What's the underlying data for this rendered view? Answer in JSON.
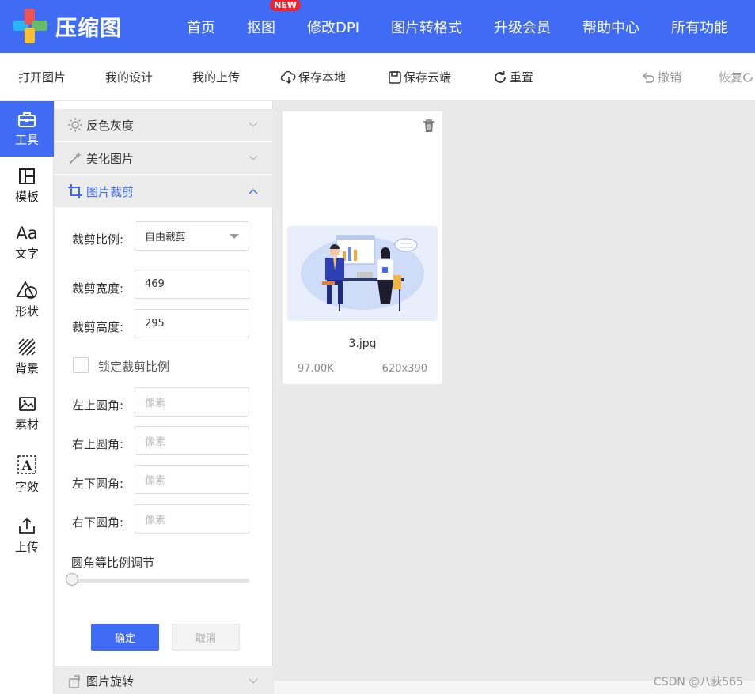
{
  "header": {
    "logo_text": "压缩图",
    "nav": [
      {
        "label": "首页"
      },
      {
        "label": "抠图",
        "badge": "NEW"
      },
      {
        "label": "修改DPI"
      },
      {
        "label": "图片转格式"
      },
      {
        "label": "升级会员"
      },
      {
        "label": "帮助中心"
      },
      {
        "label": "所有功能"
      }
    ],
    "accent_color": "#3f6bf5"
  },
  "toolbar": {
    "open_image": "打开图片",
    "my_designs": "我的设计",
    "my_uploads": "我的上传",
    "save_local": "保存本地",
    "save_cloud": "保存云端",
    "reset": "重置",
    "undo": "撤销",
    "redo": "恢复"
  },
  "rail": {
    "items": [
      {
        "label": "工具",
        "icon": "toolbox-icon",
        "active": true
      },
      {
        "label": "模板",
        "icon": "template-icon"
      },
      {
        "label": "文字",
        "icon": "text-icon"
      },
      {
        "label": "形状",
        "icon": "shape-icon"
      },
      {
        "label": "背景",
        "icon": "background-icon"
      },
      {
        "label": "素材",
        "icon": "image-material-icon"
      },
      {
        "label": "字效",
        "icon": "text-effect-icon"
      },
      {
        "label": "上传",
        "icon": "upload-icon"
      }
    ]
  },
  "panel": {
    "sections": {
      "invert_gray": "反色灰度",
      "beautify": "美化图片",
      "crop": "图片裁剪",
      "rotate": "图片旋转"
    },
    "crop": {
      "ratio_label": "裁剪比例:",
      "ratio_value": "自由裁剪",
      "width_label": "裁剪宽度:",
      "width_value": "469",
      "height_label": "裁剪高度:",
      "height_value": "295",
      "lock_label": "锁定裁剪比例",
      "lock_checked": false,
      "top_left_label": "左上圆角:",
      "top_right_label": "右上圆角:",
      "bottom_left_label": "左下圆角:",
      "bottom_right_label": "右下圆角:",
      "corner_placeholder": "像素",
      "slider_label": "圆角等比例调节",
      "slider_value": 0,
      "confirm": "确定",
      "cancel": "取消"
    }
  },
  "canvas": {
    "file": {
      "name": "3.jpg",
      "size": "97.00K",
      "dimensions": "620x390"
    }
  },
  "watermark": "CSDN @八荻565"
}
